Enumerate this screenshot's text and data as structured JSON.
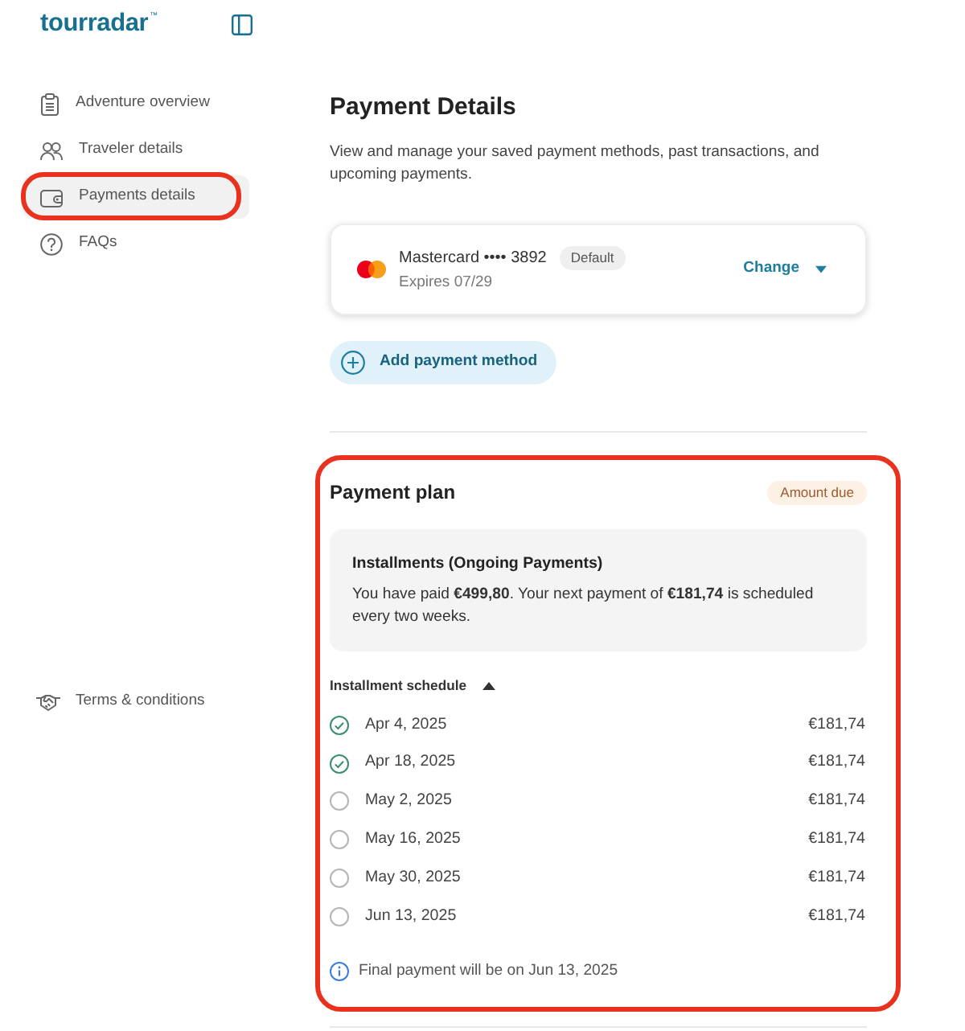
{
  "sidebar": {
    "logo": "tourradar",
    "logo_trademark": "™",
    "items": [
      {
        "label": "Adventure overview",
        "selected": false,
        "highlighted": false
      },
      {
        "label": "Traveler details",
        "selected": false,
        "highlighted": false
      },
      {
        "label": "Payments details",
        "selected": true,
        "highlighted": true
      },
      {
        "label": "FAQs",
        "selected": false,
        "highlighted": false
      }
    ],
    "footer_link": "Terms & conditions"
  },
  "main": {
    "title": "Payment Details",
    "description": "View and manage your saved payment methods, past transactions, and upcoming payments.",
    "payment_method": {
      "card": "Mastercard •••• 3892",
      "badge": "Default",
      "expiry": "Expires 07/29",
      "action": "Change"
    },
    "add_button": "Add payment method",
    "payment_plan": {
      "title": "Payment plan",
      "status_badge": "Amount due",
      "highlighted": true,
      "summary": {
        "title": "Installments (Ongoing Payments)",
        "text": "You have paid **€499,80**. Your next payment of **€181,74** is scheduled every two weeks."
      },
      "schedule": {
        "title": "Installment schedule",
        "expanded": true,
        "rows": [
          {
            "date": "Apr 4, 2025",
            "amount": "€181,74",
            "paid": true
          },
          {
            "date": "Apr 18, 2025",
            "amount": "€181,74",
            "paid": true
          },
          {
            "date": "May 2, 2025",
            "amount": "€181,74",
            "paid": false
          },
          {
            "date": "May 16, 2025",
            "amount": "€181,74",
            "paid": false
          },
          {
            "date": "May 30, 2025",
            "amount": "€181,74",
            "paid": false
          },
          {
            "date": "Jun 13, 2025",
            "amount": "€181,74",
            "paid": false
          }
        ]
      },
      "note": "Final payment will be on Jun 13, 2025"
    }
  }
}
